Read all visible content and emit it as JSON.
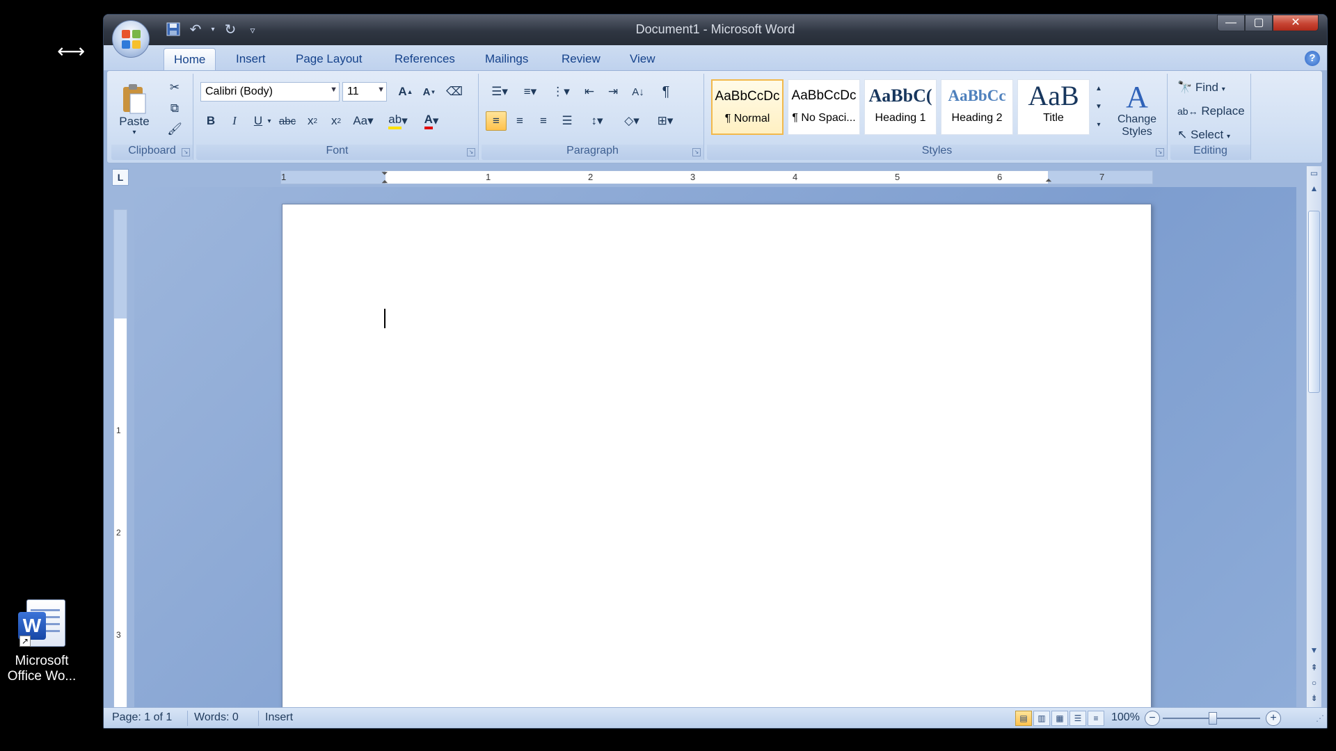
{
  "window": {
    "title": "Document1 - Microsoft Word",
    "min_icon": "minimize-icon",
    "max_icon": "maximize-icon",
    "close_icon": "close-icon"
  },
  "qat": {
    "save": "save-icon",
    "undo": "undo-icon",
    "redo": "redo-icon",
    "customize": "customize-qat-icon"
  },
  "tabs": [
    "Home",
    "Insert",
    "Page Layout",
    "References",
    "Mailings",
    "Review",
    "View"
  ],
  "ribbon": {
    "clipboard": {
      "label": "Clipboard",
      "paste": "Paste"
    },
    "font": {
      "label": "Font",
      "font_name": "Calibri (Body)",
      "font_size": "11"
    },
    "paragraph": {
      "label": "Paragraph"
    },
    "styles": {
      "label": "Styles",
      "items": [
        {
          "sample": "AaBbCcDc",
          "name": "¶ Normal"
        },
        {
          "sample": "AaBbCcDc",
          "name": "¶ No Spaci..."
        },
        {
          "sample": "AaBbC(",
          "name": "Heading 1"
        },
        {
          "sample": "AaBbCc",
          "name": "Heading 2"
        },
        {
          "sample": "AaB",
          "name": "Title"
        }
      ],
      "change_styles": "Change Styles"
    },
    "editing": {
      "label": "Editing",
      "find": "Find",
      "replace": "Replace",
      "select": "Select"
    }
  },
  "ruler": {
    "numbers": [
      "1",
      "1",
      "2",
      "3",
      "4",
      "5",
      "6",
      "7"
    ],
    "vnumbers": [
      "1",
      "2",
      "3"
    ]
  },
  "status": {
    "page": "Page: 1 of 1",
    "words": "Words: 0",
    "mode": "Insert",
    "zoom": "100%"
  },
  "desktop": {
    "icon_label_1": "Microsoft",
    "icon_label_2": "Office Wo..."
  },
  "colors": {
    "accent": "#15428b",
    "ribbon": "#d3e1f4",
    "workspace": "#9db6dc"
  }
}
